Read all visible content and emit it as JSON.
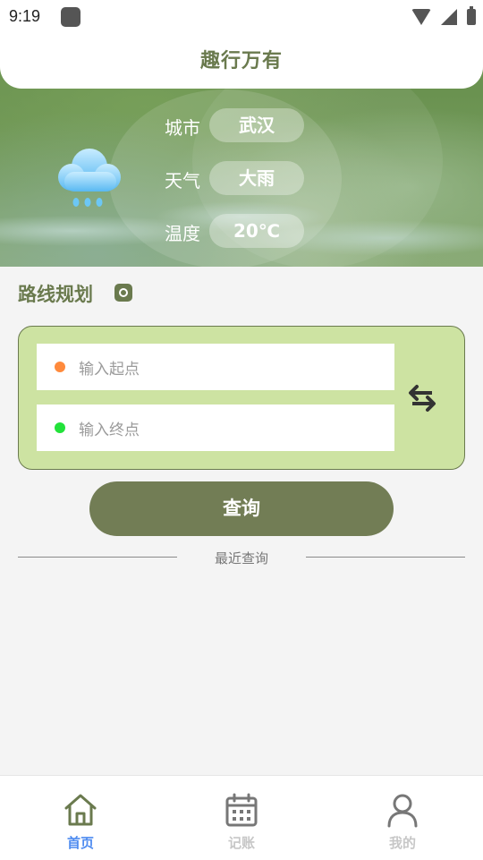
{
  "status_bar": {
    "time": "9:19"
  },
  "header": {
    "title": "趣行万有"
  },
  "weather": {
    "city_label": "城市",
    "city_value": "武汉",
    "weather_label": "天气",
    "weather_value": "大雨",
    "temp_label": "温度",
    "temp_value": "20℃",
    "icon": "rain-cloud-icon"
  },
  "route": {
    "title": "路线规划",
    "start_placeholder": "输入起点",
    "end_placeholder": "输入终点",
    "start_dot_color": "#ff8a3c",
    "end_dot_color": "#22e23a",
    "query_label": "查询",
    "recent_label": "最近查询"
  },
  "nav": {
    "items": [
      {
        "label": "首页",
        "icon": "home-icon",
        "active": true
      },
      {
        "label": "记账",
        "icon": "calendar-icon",
        "active": false
      },
      {
        "label": "我的",
        "icon": "user-icon",
        "active": false
      }
    ],
    "active_color": "#4f8cf0",
    "inactive_color": "#c7c7c7"
  },
  "colors": {
    "accent": "#6a7a4e",
    "card_bg": "#cde3a2",
    "button_bg": "#727d55"
  }
}
